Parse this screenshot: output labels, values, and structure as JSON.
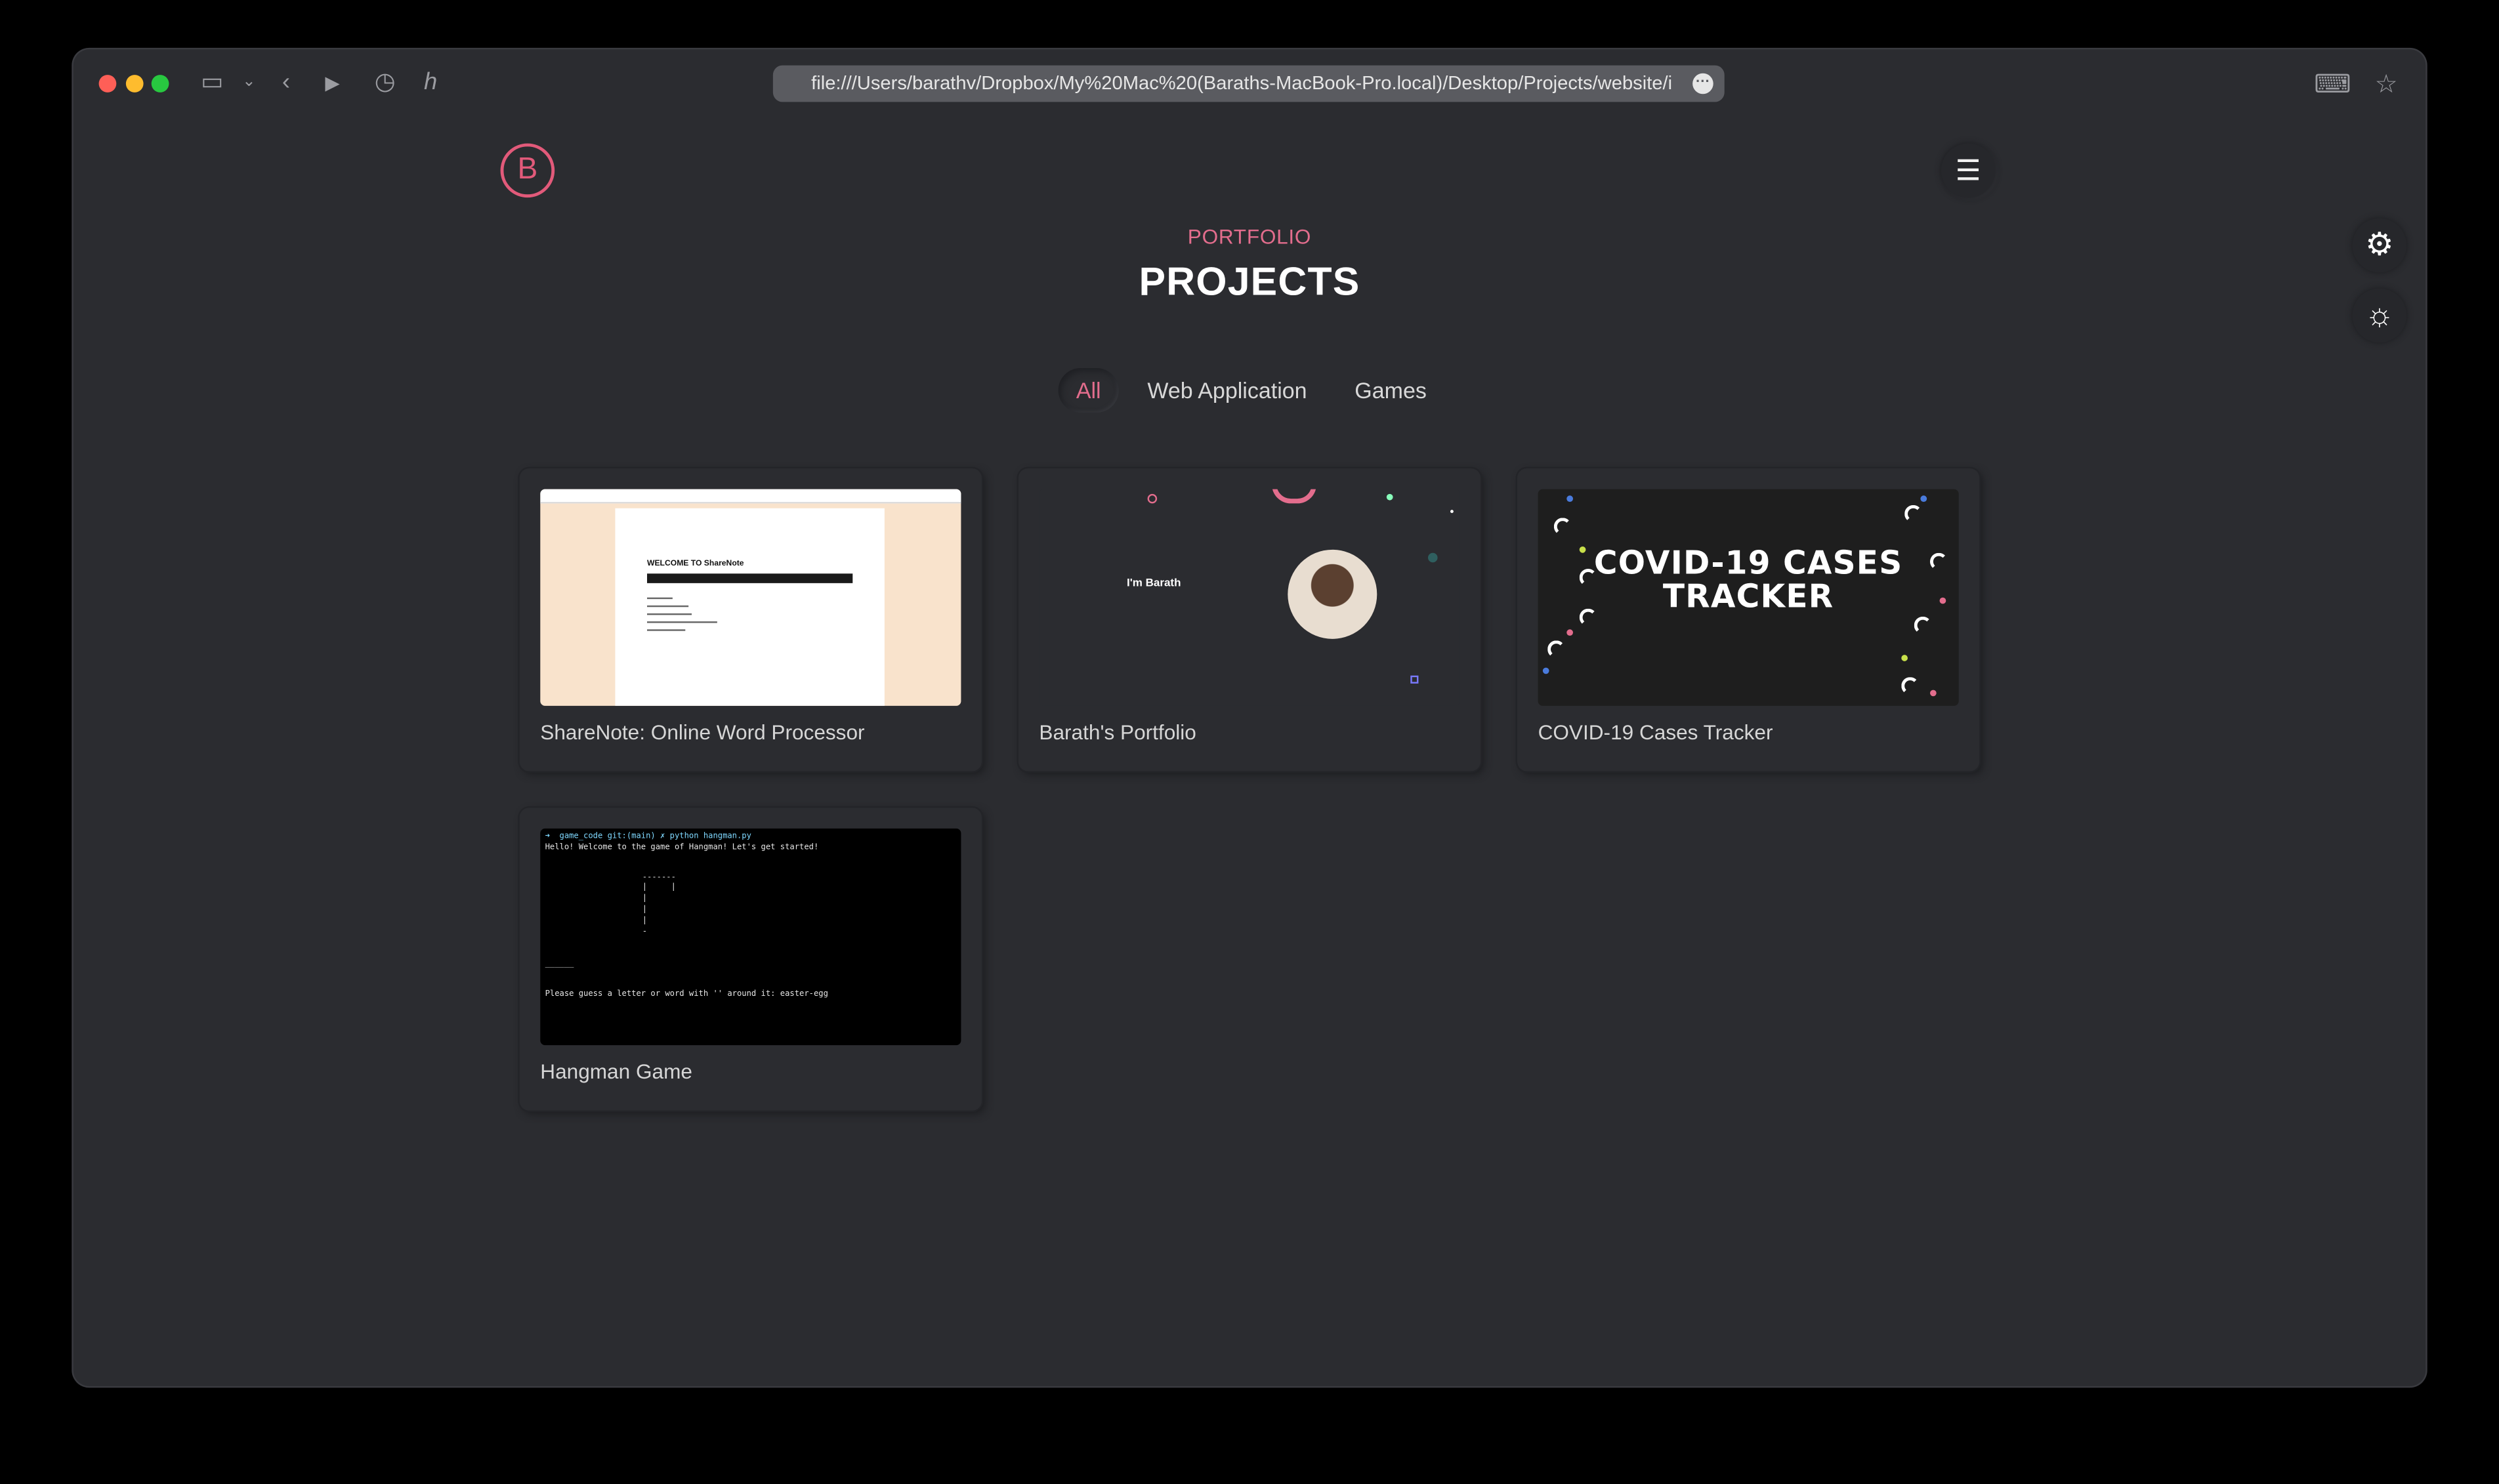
{
  "browser": {
    "url": "file:///Users/barathv/Dropbox/My%20Mac%20(Baraths-MacBook-Pro.local)/Desktop/Projects/website/index.h"
  },
  "site": {
    "logo_letter": "B",
    "eyebrow": "PORTFOLIO",
    "title": "PROJECTS"
  },
  "filters": [
    {
      "label": "All",
      "active": true
    },
    {
      "label": "Web Application",
      "active": false
    },
    {
      "label": "Games",
      "active": false
    }
  ],
  "projects": [
    {
      "label": "ShareNote: Online Word Processor",
      "thumb_title": "WELCOME TO ShareNote"
    },
    {
      "label": "Barath's Portfolio",
      "thumb_title": "I'm Barath"
    },
    {
      "label": "COVID-19 Cases Tracker",
      "thumb_title": "COVID-19 CASES TRACKER"
    },
    {
      "label": "Hangman Game",
      "thumb_lines": [
        "➜  game_code git:(main) ✗ python hangman.py",
        "Hello! Welcome to the game of Hangman! Let's get started!",
        "Please guess a letter or word with '' around it: easter-egg"
      ]
    }
  ],
  "colors": {
    "accent": "#e36d8d",
    "background": "#2b2c30"
  },
  "icons": {
    "menu": "menu-icon",
    "settings": "gear-icon",
    "theme": "sun-icon"
  }
}
